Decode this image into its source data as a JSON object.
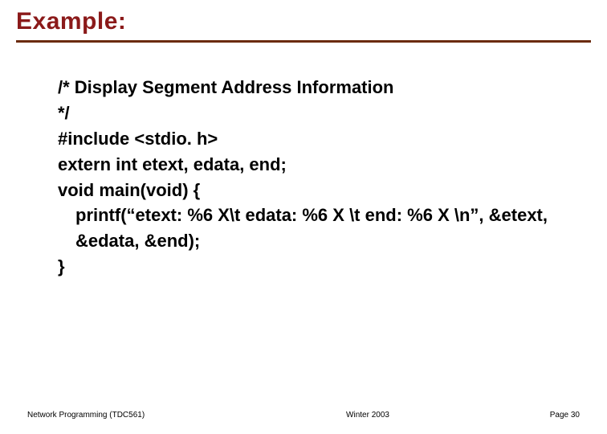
{
  "title": "Example:",
  "code": {
    "l1": "/* Display Segment Address Information",
    "l2": "*/",
    "l3": "#include <stdio. h>",
    "l4": "extern int etext, edata, end;",
    "l5": "void main(void) {",
    "l6": "printf(“etext: %6 X\\t edata: %6 X \\t end: %6 X \\n”, &etext, &edata, &end);",
    "l7": "}"
  },
  "footer": {
    "left": "Network Programming (TDC561)",
    "center": "Winter  2003",
    "right": "Page 30"
  }
}
